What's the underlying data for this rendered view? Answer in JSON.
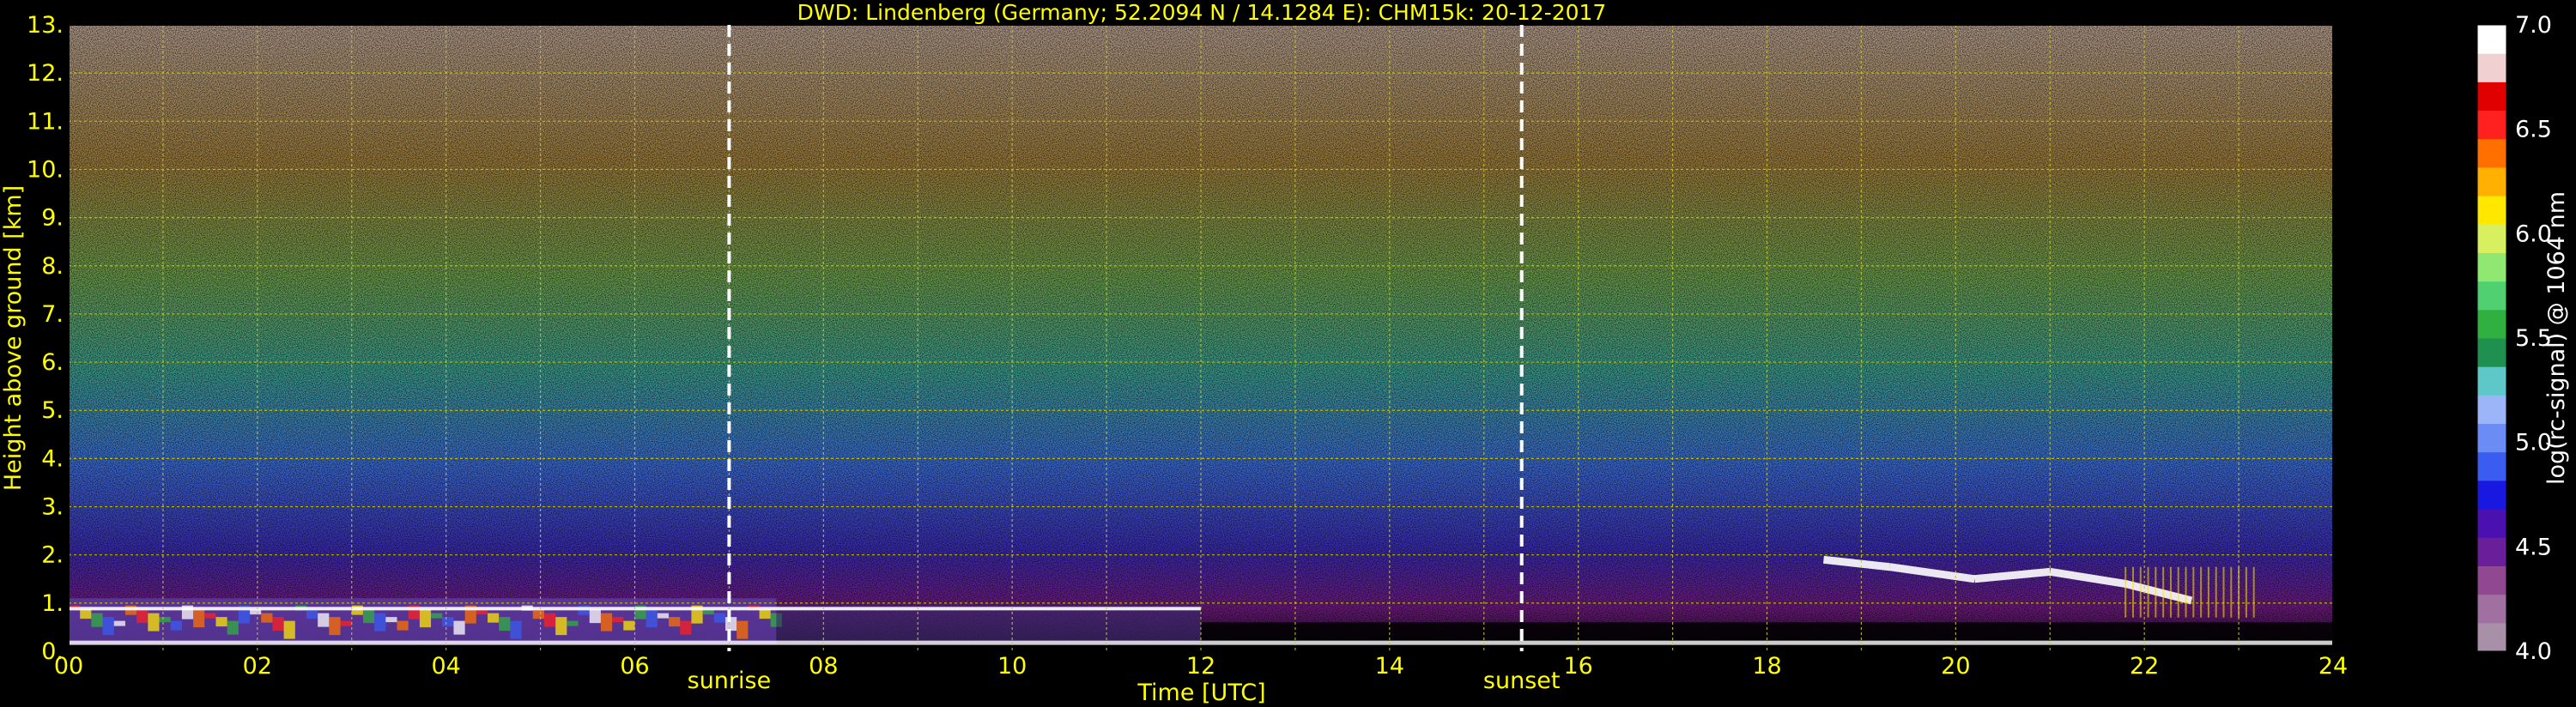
{
  "chart_data": {
    "type": "heatmap",
    "title": "DWD: Lindenberg (Germany; 52.2094 N / 14.1284 E):    CHM15k: 20-12-2017",
    "xlabel": "Time [UTC]",
    "ylabel": "Height above ground [km]",
    "xlim": [
      0,
      24
    ],
    "ylim": [
      0,
      13
    ],
    "x_tick_labels": [
      "00",
      "02",
      "04",
      "06",
      "08",
      "10",
      "12",
      "14",
      "16",
      "18",
      "20",
      "22",
      "24"
    ],
    "y_tick_labels": [
      "0.",
      "1.",
      "2.",
      "3.",
      "4.",
      "5.",
      "6.",
      "7.",
      "8.",
      "9.",
      "10.",
      "11.",
      "12.",
      "13."
    ],
    "grid": true,
    "annotations": [
      {
        "label": "sunrise",
        "time": 7.0
      },
      {
        "label": "sunset",
        "time": 15.4
      }
    ],
    "colorbar": {
      "label": "log(rc-signal) @ 1064 nm",
      "range": [
        4.0,
        7.0
      ],
      "tick_labels": [
        "4.0",
        "4.5",
        "5.0",
        "5.5",
        "6.0",
        "6.5",
        "7.0"
      ],
      "colors": [
        "#a890a8",
        "#a070a0",
        "#904890",
        "#6a1f9a",
        "#4a10b0",
        "#1818e0",
        "#3a5cf0",
        "#6c8cf5",
        "#9cb4f8",
        "#5ec8c8",
        "#1f9050",
        "#30b040",
        "#50d070",
        "#90e870",
        "#d8f060",
        "#ffe800",
        "#ffb000",
        "#ff7000",
        "#ff2020",
        "#e00000",
        "#f0d0d0",
        "#ffffff"
      ]
    },
    "features": [
      {
        "name": "boundary layer aerosol",
        "time_start": 0,
        "time_end": 24,
        "height_km": 0.9
      },
      {
        "name": "cloud band",
        "time_start": 18.6,
        "time_end": 22.5,
        "height_km_start": 1.8,
        "height_km_end": 1.2
      }
    ]
  },
  "colors": {
    "background": "#000000",
    "text": "#ffff00",
    "grid": "#cccc00",
    "colorbar_text": "#ffffff"
  }
}
